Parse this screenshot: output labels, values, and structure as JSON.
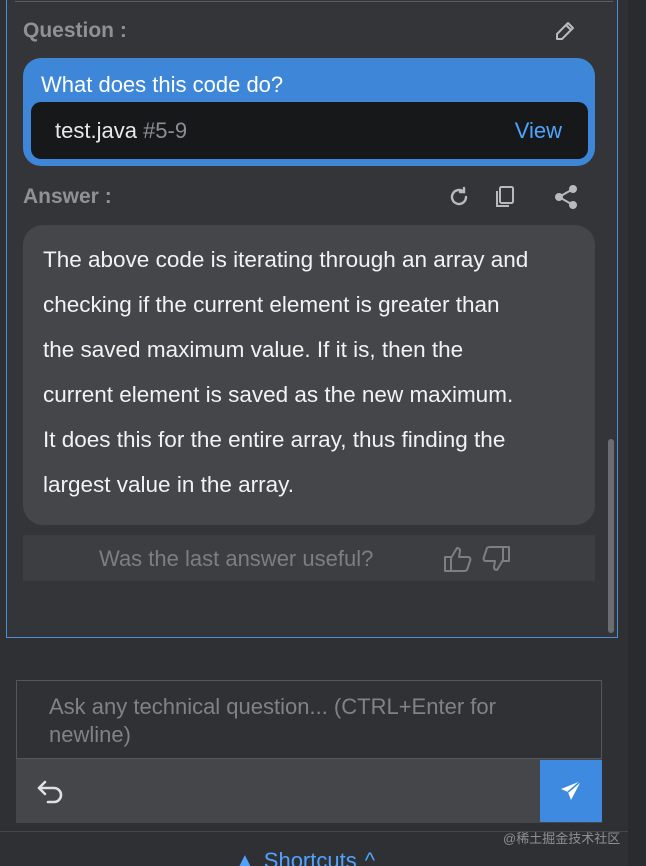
{
  "question_section": {
    "label": "Question :",
    "edit_icon": "pencil-icon",
    "question_text": "What does this code do?",
    "file_name": "test.java",
    "line_range": "#5-9",
    "view_label": "View"
  },
  "answer_section": {
    "label": "Answer :",
    "icons": [
      "refresh-icon",
      "copy-icon",
      "share-icon"
    ],
    "lines": [
      "The above code is iterating through an array and",
      "checking if the current element is greater than",
      "the saved maximum value. If it is, then the",
      "current element is saved as the new maximum.",
      "It does this for the entire array, thus finding the",
      "largest value in the array."
    ]
  },
  "feedback": {
    "prompt": "Was the last answer useful?",
    "icons": [
      "thumbs-up-icon",
      "thumbs-down-icon"
    ]
  },
  "input": {
    "placeholder": "Ask any technical question... (CTRL+Enter for newline)",
    "undo_icon": "undo-icon",
    "send_icon": "send-icon"
  },
  "footer": {
    "shortcuts_label": "Shortcuts",
    "watermark": "@稀土掘金技术社区"
  },
  "colors": {
    "accent": "#3e86d8",
    "link": "#4fa3ff",
    "background": "#2f3033"
  }
}
